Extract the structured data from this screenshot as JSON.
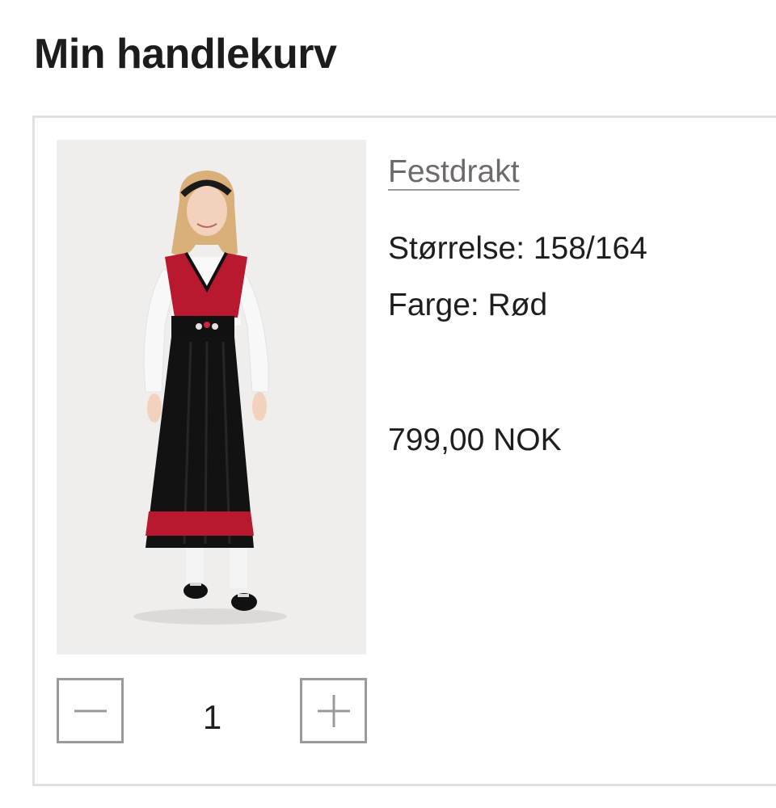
{
  "page": {
    "title": "Min handlekurv"
  },
  "cart": {
    "items": [
      {
        "name": "Festdrakt",
        "size_text": "Størrelse: 158/164",
        "color_text": "Farge: Rød",
        "price": "799,00 NOK",
        "quantity": "1",
        "image": "product-photo-girl-in-bunad-dress"
      }
    ]
  },
  "icons": {
    "decrease": "minus-icon",
    "increase": "plus-icon"
  },
  "colors": {
    "text": "#1e1e1e",
    "link": "#6e6a6a",
    "border": "#e1e1e1",
    "button_border": "#9a9a9a",
    "dress_red": "#b8192f",
    "dress_black": "#111111"
  }
}
